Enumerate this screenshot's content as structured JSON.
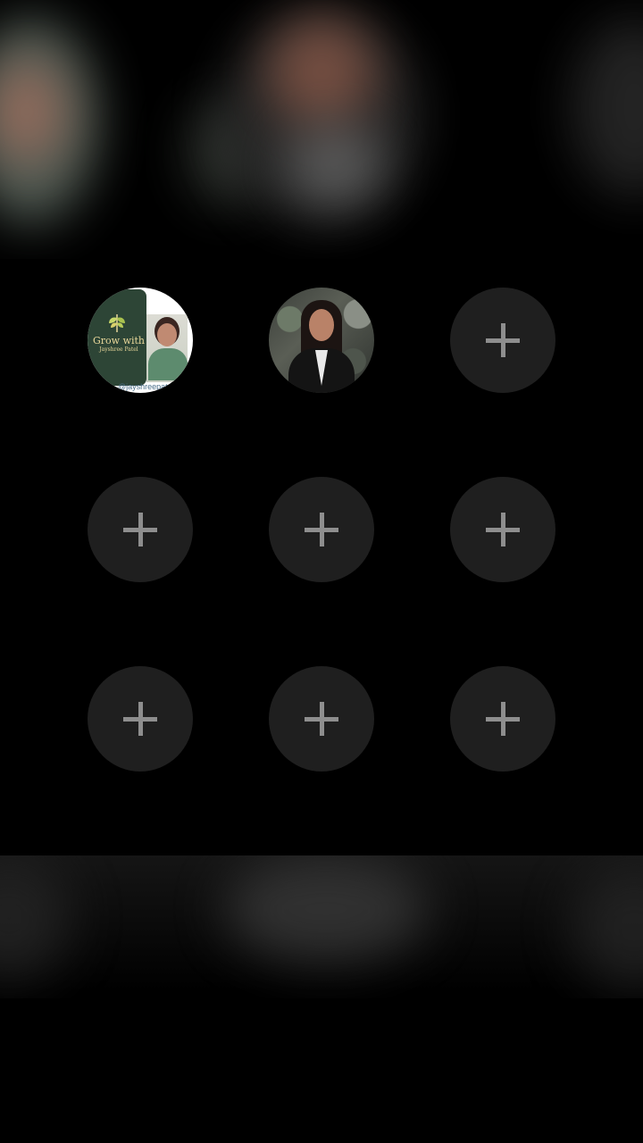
{
  "app": {
    "screen": "highlights-cover-picker"
  },
  "slots": [
    {
      "type": "avatar",
      "name": "avatar-grow-with",
      "brand_title": "Grow with",
      "brand_subtitle": "Jayshree Patel",
      "handle": "@jayshreepatel"
    },
    {
      "type": "avatar",
      "name": "avatar-profile-photo"
    },
    {
      "type": "add",
      "icon": "plus-icon"
    },
    {
      "type": "add",
      "icon": "plus-icon"
    },
    {
      "type": "add",
      "icon": "plus-icon"
    },
    {
      "type": "add",
      "icon": "plus-icon"
    },
    {
      "type": "add",
      "icon": "plus-icon"
    },
    {
      "type": "add",
      "icon": "plus-icon"
    },
    {
      "type": "add",
      "icon": "plus-icon"
    }
  ],
  "colors": {
    "background": "#000000",
    "slot_fill": "#1f1f1f",
    "plus": "#8e8e8e",
    "brand_green": "#2d4536",
    "brand_gold": "#e8d79a"
  }
}
